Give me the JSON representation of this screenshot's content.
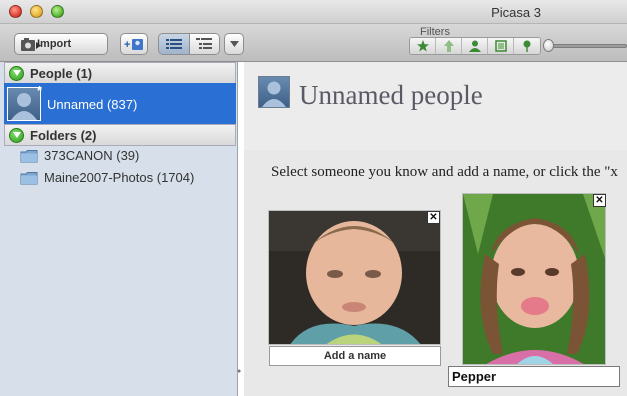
{
  "window": {
    "title": "Picasa 3"
  },
  "toolbar": {
    "import_label": "Import",
    "filters_label": "Filters"
  },
  "sidebar": {
    "people_header": "People (1)",
    "people_items": [
      {
        "label": "Unnamed (837)"
      }
    ],
    "folders_header": "Folders (2)",
    "folders": [
      {
        "label": "373CANON (39)"
      },
      {
        "label": "Maine2007-Photos (1704)"
      }
    ]
  },
  "main": {
    "title": "Unnamed people",
    "instruction": "Select someone you know and add a name, or click the \"x",
    "faces": [
      {
        "name_button": "Add a name"
      },
      {
        "name_value": "Pepper"
      }
    ]
  },
  "colors": {
    "selection": "#2a6fd3",
    "sidebar_bg": "#d7e0ea"
  }
}
